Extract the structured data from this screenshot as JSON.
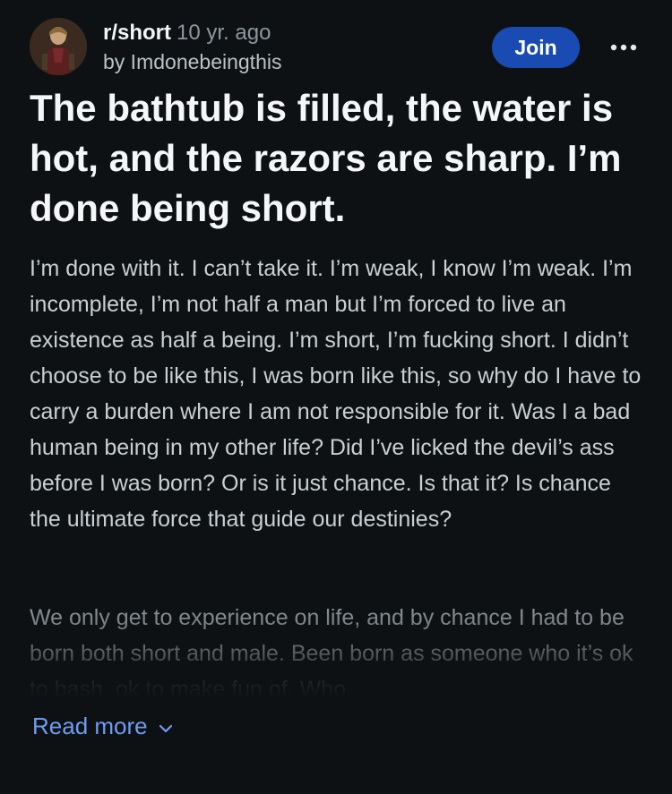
{
  "post": {
    "subreddit": "r/short",
    "age": "10 yr. ago",
    "author_line": "by Imdonebeingthis",
    "join_label": "Join",
    "title": "The bathtub is filled, the water is hot, and the razors are sharp. I’m done being short.",
    "body_paragraph_1": "I’m done with it. I can’t take it. I’m weak, I know I’m weak. I’m incomplete, I’m not half a man but I’m forced to live an existence as half a being. I’m short, I’m fucking short. I didn’t choose to be like this, I was born like this, so why do I have to carry a burden where I am not responsible for it. Was I a bad human being in my other life? Did I’ve licked the devil’s ass before I was born? Or is it just chance. Is that it? Is chance the ultimate force that guide our destinies?",
    "body_paragraph_2": "We only get to experience on life, and by chance I had to be born both short and male. Been born as someone who it’s ok to bash, ok to make fun of. Who",
    "read_more_label": "Read more"
  },
  "icons": {
    "avatar": "avatar-image",
    "more": "more-horizontal-icon",
    "read_more_chevron": "chevron-down-icon"
  },
  "colors": {
    "background": "#0e1113",
    "join_button": "#1a4bb3",
    "link": "#6d9cf2",
    "muted_text": "#8b979d"
  }
}
